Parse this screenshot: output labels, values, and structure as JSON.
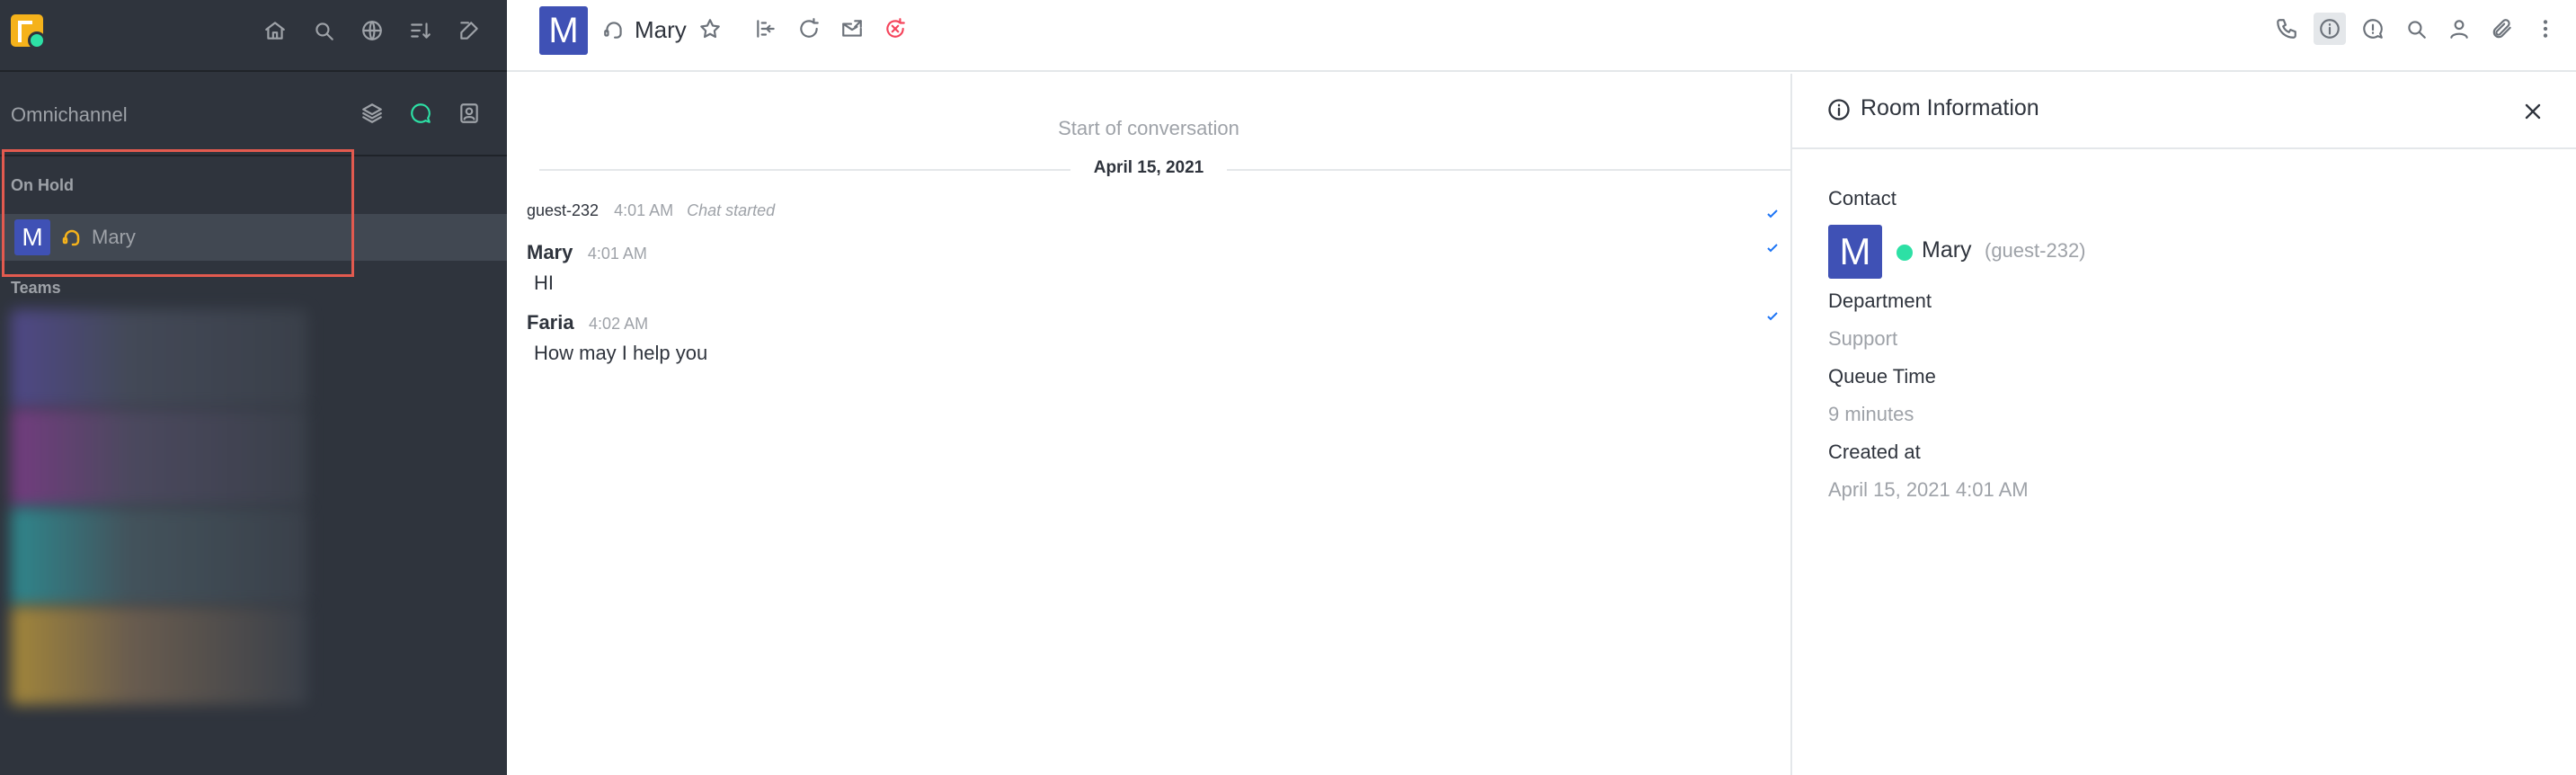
{
  "sidebar": {
    "section_title": "Omnichannel",
    "groups": [
      {
        "label": "On Hold"
      },
      {
        "label": "Teams"
      }
    ],
    "rooms": [
      {
        "avatar_letter": "M",
        "name": "Mary"
      }
    ],
    "header_icons": [
      "home-icon",
      "search-icon",
      "directory-icon",
      "sort-icon",
      "create-new-icon"
    ],
    "omnichannel_icons": [
      "queue-icon",
      "chat-icon",
      "contact-center-icon"
    ]
  },
  "header": {
    "avatar_letter": "M",
    "room_name": "Mary",
    "action_icons": [
      "move-to-queue-icon",
      "forward-icon",
      "transcript-icon",
      "close-chat-icon"
    ],
    "toolbar_icons": [
      "call-icon",
      "room-info-icon",
      "discussion-icon",
      "search-messages-icon",
      "contact-icon",
      "files-icon",
      "kebab-icon"
    ]
  },
  "messages": {
    "start_text": "Start of conversation",
    "date": "April 15, 2021",
    "system": {
      "user": "guest-232",
      "time": "4:01 AM",
      "text": "Chat started"
    },
    "items": [
      {
        "user": "Mary",
        "time": "4:01 AM",
        "body": "HI"
      },
      {
        "user": "Faria",
        "time": "4:02 AM",
        "body": "How may I help you"
      }
    ]
  },
  "room_info": {
    "title": "Room Information",
    "contact_label": "Contact",
    "contact": {
      "avatar_letter": "M",
      "name": "Mary",
      "username": "(guest-232)"
    },
    "fields": [
      {
        "label": "Department",
        "value": "Support"
      },
      {
        "label": "Queue Time",
        "value": "9 minutes"
      },
      {
        "label": "Created at",
        "value": "April 15, 2021 4:01 AM"
      }
    ]
  },
  "colors": {
    "sidebar_bg": "#2f343d",
    "accent_green": "#2de0a5",
    "avatar_blue": "#3f51b5",
    "highlight_red": "#e35a4f",
    "headset_yellow": "#f5b21b"
  }
}
